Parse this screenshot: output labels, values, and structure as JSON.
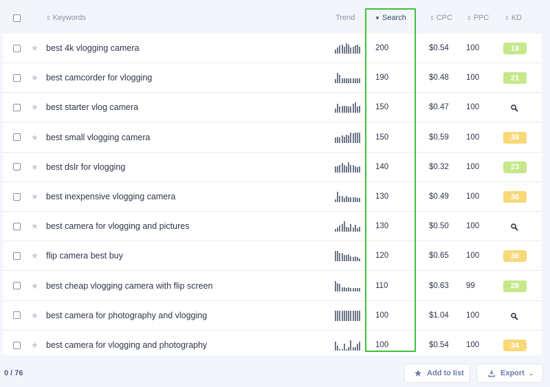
{
  "header": {
    "keywords": "Keywords",
    "trend": "Trend",
    "search": "Search",
    "cpc": "CPC",
    "ppc": "PPC",
    "kd": "KD"
  },
  "colors": {
    "kd_green": "#c6e88a",
    "kd_yellow": "#f7d97a",
    "highlight": "#3fbf3a"
  },
  "rows": [
    {
      "keyword": "best 4k vlogging camera",
      "search": "200",
      "cpc": "$0.54",
      "ppc": "100",
      "kd": "18",
      "kd_level": "green",
      "trend": [
        4,
        6,
        8,
        9,
        7,
        10,
        9,
        6,
        7,
        8,
        9,
        7
      ]
    },
    {
      "keyword": "best camcorder for vlogging",
      "search": "190",
      "cpc": "$0.48",
      "ppc": "100",
      "kd": "21",
      "kd_level": "green",
      "trend": [
        4,
        10,
        8,
        5,
        5,
        5,
        5,
        5,
        5,
        5,
        5,
        5
      ]
    },
    {
      "keyword": "best starter vlog camera",
      "search": "150",
      "cpc": "$0.47",
      "ppc": "100",
      "kd": "",
      "kd_level": "search",
      "trend": [
        4,
        9,
        6,
        7,
        7,
        7,
        6,
        6,
        9,
        10,
        6,
        7
      ]
    },
    {
      "keyword": "best small vlogging camera",
      "search": "150",
      "cpc": "$0.59",
      "ppc": "100",
      "kd": "38",
      "kd_level": "yellow",
      "trend": [
        5,
        6,
        5,
        7,
        6,
        8,
        7,
        10,
        9,
        10,
        10,
        10
      ]
    },
    {
      "keyword": "best dslr for vlogging",
      "search": "140",
      "cpc": "$0.32",
      "ppc": "100",
      "kd": "23",
      "kd_level": "green",
      "trend": [
        6,
        6,
        7,
        9,
        7,
        6,
        10,
        7,
        7,
        6,
        5,
        6
      ]
    },
    {
      "keyword": "best inexpensive vlogging camera",
      "search": "130",
      "cpc": "$0.49",
      "ppc": "100",
      "kd": "36",
      "kd_level": "yellow",
      "trend": [
        3,
        10,
        6,
        6,
        4,
        6,
        5,
        5,
        5,
        5,
        4,
        4
      ]
    },
    {
      "keyword": "best camera for vlogging and pictures",
      "search": "130",
      "cpc": "$0.50",
      "ppc": "100",
      "kd": "",
      "kd_level": "search",
      "trend": [
        3,
        5,
        7,
        9,
        12,
        6,
        5,
        9,
        5,
        8,
        4,
        6
      ]
    },
    {
      "keyword": "flip camera best buy",
      "search": "120",
      "cpc": "$0.65",
      "ppc": "100",
      "kd": "36",
      "kd_level": "yellow",
      "trend": [
        10,
        10,
        8,
        8,
        6,
        6,
        7,
        5,
        4,
        5,
        4,
        3
      ]
    },
    {
      "keyword": "best cheap vlogging camera with flip screen",
      "search": "110",
      "cpc": "$0.63",
      "ppc": "99",
      "kd": "28",
      "kd_level": "green",
      "trend": [
        10,
        8,
        7,
        4,
        4,
        3,
        4,
        3,
        3,
        3,
        3,
        3
      ]
    },
    {
      "keyword": "best camera for photography and vlogging",
      "search": "100",
      "cpc": "$1.04",
      "ppc": "100",
      "kd": "",
      "kd_level": "search",
      "trend": [
        10,
        10,
        10,
        10,
        10,
        10,
        10,
        10,
        10,
        10,
        10,
        10
      ]
    },
    {
      "keyword": "best camera for vlogging and photography",
      "search": "100",
      "cpc": "$0.54",
      "ppc": "100",
      "kd": "34",
      "kd_level": "yellow",
      "trend": [
        8,
        4,
        1,
        1,
        6,
        1,
        3,
        9,
        3,
        3,
        6,
        8
      ]
    }
  ],
  "footer": {
    "count": "0 / 76",
    "add_to_list": "Add to list",
    "export": "Export"
  }
}
